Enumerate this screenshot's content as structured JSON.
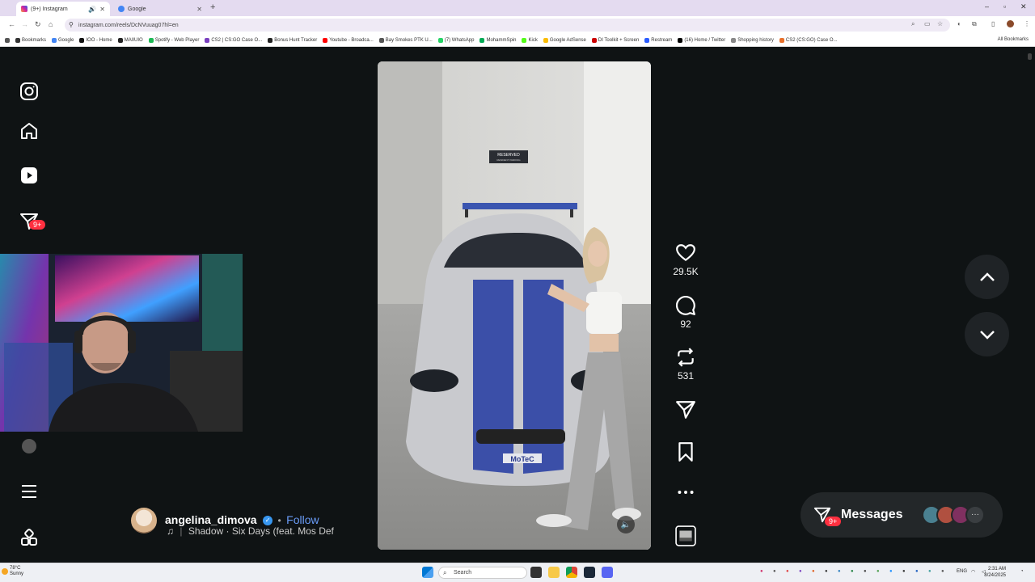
{
  "browser": {
    "tabs": [
      {
        "title": "(9+) Instagram",
        "active": true
      },
      {
        "title": "Google",
        "active": false
      }
    ],
    "url": "instagram.com/reels/DcNVuuag07hl=en",
    "bookmarks": [
      "Bookmarks",
      "Google",
      "IOO - Home",
      "MAIIUIO",
      "Spotify - Web Player",
      "CS2 | CS:GO Case O...",
      "Bonus Hunt Tracker",
      "Youtube - Broadca...",
      "Bay Smokes PTK U...",
      "(7) WhatsApp",
      "MohammSpin",
      "Kick",
      "Google AdSense",
      "DI Toolkit + Screen",
      "Restream",
      "(16) Home / Twitter",
      "Shopping history",
      "CS2 (CS:GO) Case O..."
    ],
    "bookmarks_all": "All Bookmarks"
  },
  "instagram": {
    "notification_badge": "9+",
    "actions": {
      "likes": "29.5K",
      "comments": "92",
      "reposts": "531"
    },
    "author": {
      "username": "angelina_dimova",
      "separator": "•",
      "follow_label": "Follow"
    },
    "music": "Shadow · Six Days (feat. Mos Def",
    "messages": {
      "label": "Messages",
      "badge": "9+",
      "more": "···"
    },
    "video_sign": {
      "line1": "RESERVED",
      "line2": "RESIDENT PARKING"
    },
    "car_plate": "MoTeC"
  },
  "taskbar": {
    "weather_temp": "78°C",
    "weather_desc": "Sunny",
    "search_label": "Search",
    "language": "ENG",
    "time": "2:31 AM",
    "date": "8/24/2025"
  }
}
